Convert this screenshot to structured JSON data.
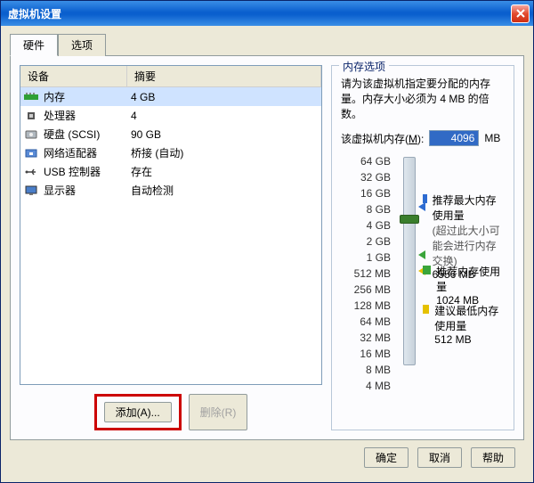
{
  "window": {
    "title": "虚拟机设置"
  },
  "tabs": {
    "hw": "硬件",
    "opt": "选项"
  },
  "listhead": {
    "dev": "设备",
    "sum": "摘要"
  },
  "devices": [
    {
      "name": "内存",
      "summary": "4 GB",
      "icon": "ram"
    },
    {
      "name": "处理器",
      "summary": "4",
      "icon": "cpu"
    },
    {
      "name": "硬盘 (SCSI)",
      "summary": "90 GB",
      "icon": "hdd"
    },
    {
      "name": "网络适配器",
      "summary": "桥接 (自动)",
      "icon": "nic"
    },
    {
      "name": "USB 控制器",
      "summary": "存在",
      "icon": "usb"
    },
    {
      "name": "显示器",
      "summary": "自动检测",
      "icon": "monitor"
    }
  ],
  "buttons": {
    "add": "添加(A)...",
    "remove": "删除(R)",
    "ok": "确定",
    "cancel": "取消",
    "help": "帮助"
  },
  "mem": {
    "legend": "内存选项",
    "desc": "请为该虚拟机指定要分配的内存量。内存大小必须为 4 MB 的倍数。",
    "label_pre": "该虚拟机内存(",
    "label_hot": "M",
    "label_post": "):",
    "value": "4096",
    "unit": "MB",
    "ticks": [
      "64 GB",
      "32 GB",
      "16 GB",
      "8 GB",
      "4 GB",
      "2 GB",
      "1 GB",
      "512 MB",
      "256 MB",
      "128 MB",
      "64 MB",
      "32 MB",
      "16 MB",
      "8 MB",
      "4 MB"
    ],
    "hint_max_title": "推荐最大内存使用量",
    "hint_max_sub": "(超过此大小可能会进行内存交换)",
    "hint_max_val": "6556 MB",
    "hint_rec_title": "推荐内存使用量",
    "hint_rec_val": "1024 MB",
    "hint_min_title": "建议最低内存使用量",
    "hint_min_val": "512 MB"
  }
}
